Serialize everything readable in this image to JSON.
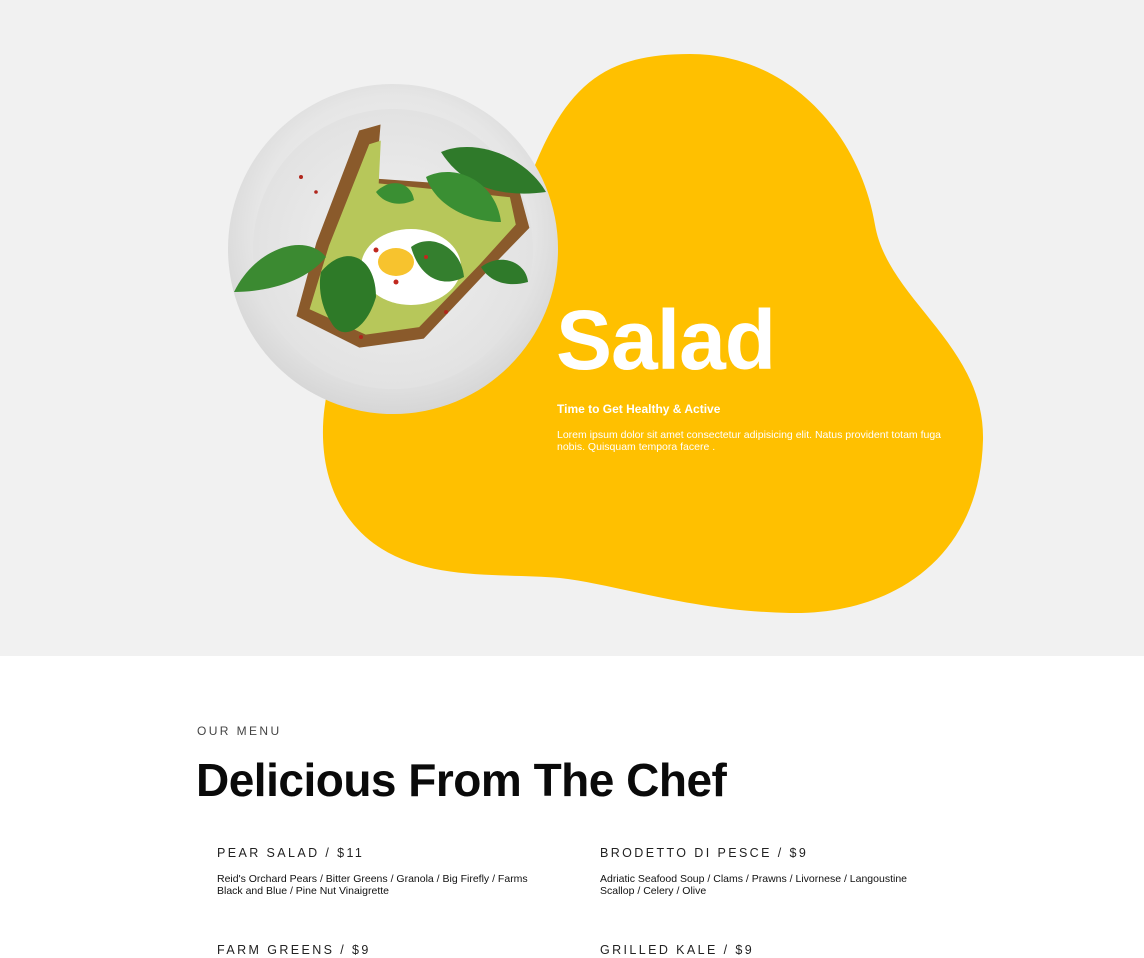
{
  "hero": {
    "title": "Salad",
    "subtitle": "Time to Get Healthy & Active",
    "body": "Lorem ipsum dolor sit amet consectetur adipisicing elit. Natus provident totam fuga nobis. Quisquam tempora facere .",
    "accent_color": "#ffc000",
    "background_color": "#f1f1f1",
    "image": "avocado-toast-plate"
  },
  "menu": {
    "eyebrow": "OUR MENU",
    "title": "Delicious From The Chef",
    "items": [
      {
        "name": "PEAR SALAD / $11",
        "description": "Reid's Orchard Pears / Bitter Greens / Granola / Big Firefly / Farms Black and Blue / Pine Nut Vinaigrette"
      },
      {
        "name": "BRODETTO DI PESCE / $9",
        "description": "Adriatic Seafood Soup / Clams / Prawns / Livornese / Langoustine Scallop / Celery / Olive"
      },
      {
        "name": "FARM GREENS / $9",
        "description": ""
      },
      {
        "name": "GRILLED KALE / $9",
        "description": ""
      }
    ]
  }
}
